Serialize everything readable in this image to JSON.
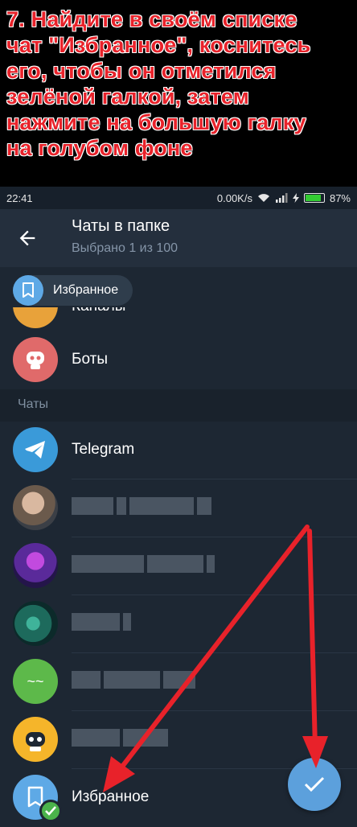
{
  "banner": {
    "text": "7. Найдите в своём списке\nчат \"Избранное\", коснитесь\nего, чтобы он отметился\nзелёной галкой, затем\nнажмите на большую галку\nна голубом фоне"
  },
  "statusbar": {
    "time": "22:41",
    "speed": "0.00K/s",
    "battery_percent": "87%",
    "battery_level": 0.87
  },
  "header": {
    "title": "Чаты в папке",
    "subtitle": "Выбрано 1 из 100",
    "back_icon": "arrow-left-icon"
  },
  "chip": {
    "label": "Избранное",
    "icon": "bookmark-icon"
  },
  "list": {
    "partial_item": "Каналы",
    "bots_label": "Боты",
    "section_label": "Чаты",
    "telegram_label": "Telegram",
    "saved_label": "Избранное"
  },
  "colors": {
    "accent": "#5ca0dc",
    "check_green": "#4bb34b",
    "banner_red": "#e8222a",
    "background": "#1d2733"
  }
}
